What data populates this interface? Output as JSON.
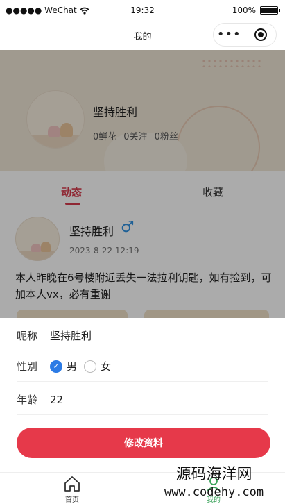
{
  "status_bar": {
    "carrier": "●●●●● WeChat",
    "time": "19:32",
    "battery": "100%"
  },
  "nav": {
    "title": "我的",
    "more": "•••"
  },
  "profile": {
    "name": "坚持胜利",
    "stats": [
      "0鲜花",
      "0关注",
      "0粉丝"
    ]
  },
  "tabs": {
    "active": "动态",
    "other": "收藏"
  },
  "post": {
    "name": "坚持胜利",
    "gender_icon": "♂",
    "time": "2023-8-22 12:19",
    "text": "本人昨晚在6号楼附近丢失一法拉利钥匙，如有捡到，可加本人vx，必有重谢"
  },
  "form": {
    "nickname_label": "昵称",
    "nickname_value": "坚持胜利",
    "gender_label": "性别",
    "gender_male": "男",
    "gender_female": "女",
    "gender_selected": "男",
    "age_label": "年龄",
    "age_value": "22",
    "submit_label": "修改资料"
  },
  "tabbar": {
    "home": "首页",
    "mine": "我的",
    "active_color": "#3aa35a"
  },
  "colors": {
    "accent": "#e6394a",
    "radio_checked": "#2c7be5",
    "tab_active": "#d63b4c"
  },
  "watermark": {
    "line1": "源码海洋网",
    "line2": "www.codehy.com"
  }
}
